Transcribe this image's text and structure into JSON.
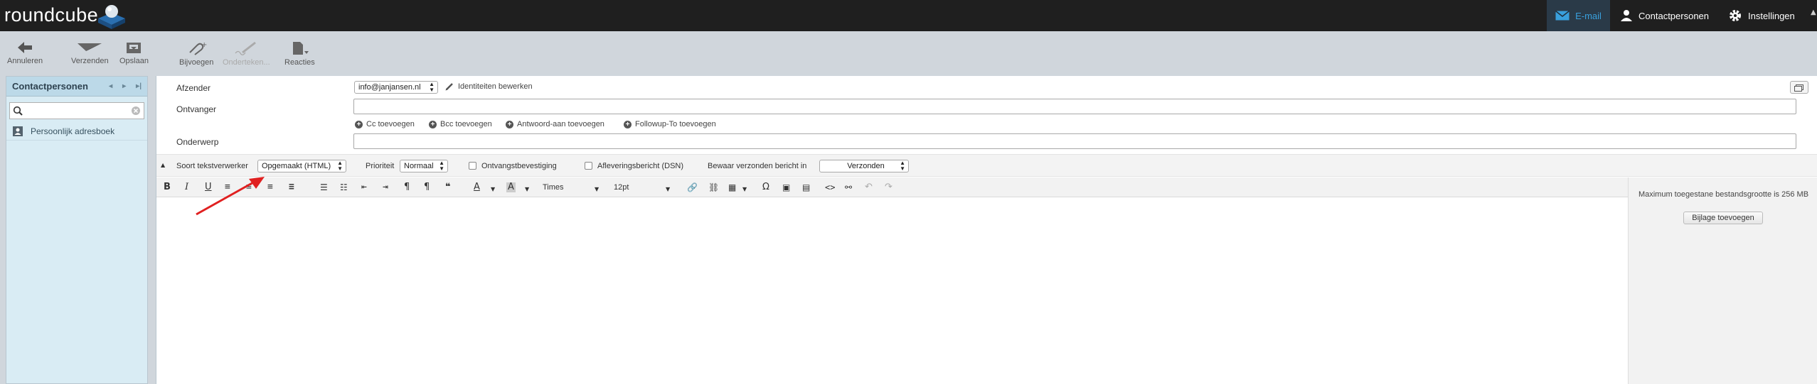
{
  "app": {
    "logo_text": "roundcube"
  },
  "topnav": {
    "mail": "E-mail",
    "contacts": "Contactpersonen",
    "settings": "Instellingen"
  },
  "toolbar": {
    "cancel": "Annuleren",
    "send": "Verzenden",
    "save": "Opslaan",
    "attach": "Bijvoegen",
    "sign": "Onderteken...",
    "responses": "Reacties"
  },
  "sidebar": {
    "title": "Contactpersonen",
    "search_placeholder": "",
    "items": [
      {
        "label": "Persoonlijk adresboek"
      }
    ]
  },
  "compose": {
    "from_label": "Afzender",
    "from_value": "info@janjansen.nl",
    "edit_identities": "Identiteiten bewerken",
    "to_label": "Ontvanger",
    "add_cc": "Cc toevoegen",
    "add_bcc": "Bcc toevoegen",
    "add_replyto": "Antwoord-aan toevoegen",
    "add_followupto": "Followup-To toevoegen",
    "subject_label": "Onderwerp"
  },
  "options": {
    "editor_type_label": "Soort tekstverwerker",
    "editor_type_value": "Opgemaakt (HTML)",
    "priority_label": "Prioriteit",
    "priority_value": "Normaal",
    "receipt_label": "Ontvangstbevestiging",
    "dsn_label": "Afleveringsbericht (DSN)",
    "save_sent_label": "Bewaar verzonden bericht in",
    "save_sent_value": "Verzonden"
  },
  "editor": {
    "font_family": "Times",
    "font_size": "12pt"
  },
  "attachments": {
    "max_size_text": "Maximum toegestane bestandsgrootte is 256 MB",
    "add_button": "Bijlage toevoegen"
  },
  "colors": {
    "topbar": "#1f1f1f",
    "accent": "#39a0dd",
    "sidebar": "#d9ecf4",
    "annotation_arrow": "#e02020"
  }
}
